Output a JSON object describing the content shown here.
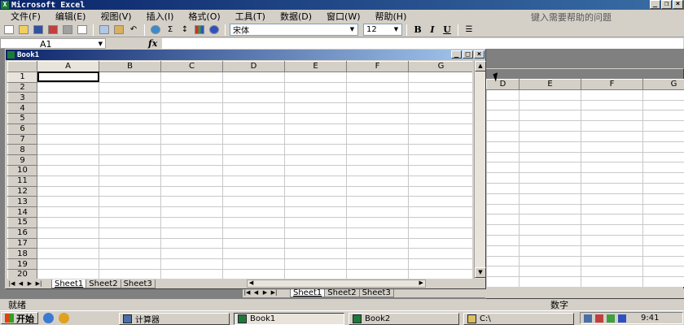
{
  "app": {
    "title": "Microsoft Excel",
    "icon": "excel-icon"
  },
  "menu": [
    "文件(F)",
    "编辑(E)",
    "视图(V)",
    "插入(I)",
    "格式(O)",
    "工具(T)",
    "数据(D)",
    "窗口(W)",
    "帮助(H)"
  ],
  "help_prompt": "键入需要帮助的问题",
  "toolbar": {
    "font_name": "宋体",
    "font_size": "12",
    "bold": "B",
    "italic": "I",
    "underline": "U",
    "sum": "Σ",
    "sort": "↕"
  },
  "formula_bar": {
    "name_box": "A1",
    "fx": "fx",
    "value": ""
  },
  "book1": {
    "title": "Book1",
    "columns": [
      "A",
      "B",
      "C",
      "D",
      "E",
      "F",
      "G"
    ],
    "rows": [
      "1",
      "2",
      "3",
      "4",
      "5",
      "6",
      "7",
      "8",
      "9",
      "10",
      "11",
      "12",
      "13",
      "14",
      "15",
      "16",
      "17",
      "18",
      "19",
      "20"
    ],
    "active_cell": "A1",
    "sheets": [
      "Sheet1",
      "Sheet2",
      "Sheet3"
    ],
    "active_sheet": "Sheet1"
  },
  "book2": {
    "columns": [
      "D",
      "E",
      "F",
      "G"
    ],
    "sheets": [
      "Sheet1",
      "Sheet2",
      "Sheet3"
    ],
    "active_sheet": "Sheet1"
  },
  "status": {
    "left": "就绪",
    "right": "数字"
  },
  "taskbar": {
    "start": "开始",
    "tasks": [
      "计算器",
      "Book1",
      "Book2",
      "C:\\"
    ],
    "clock": "9:41"
  }
}
